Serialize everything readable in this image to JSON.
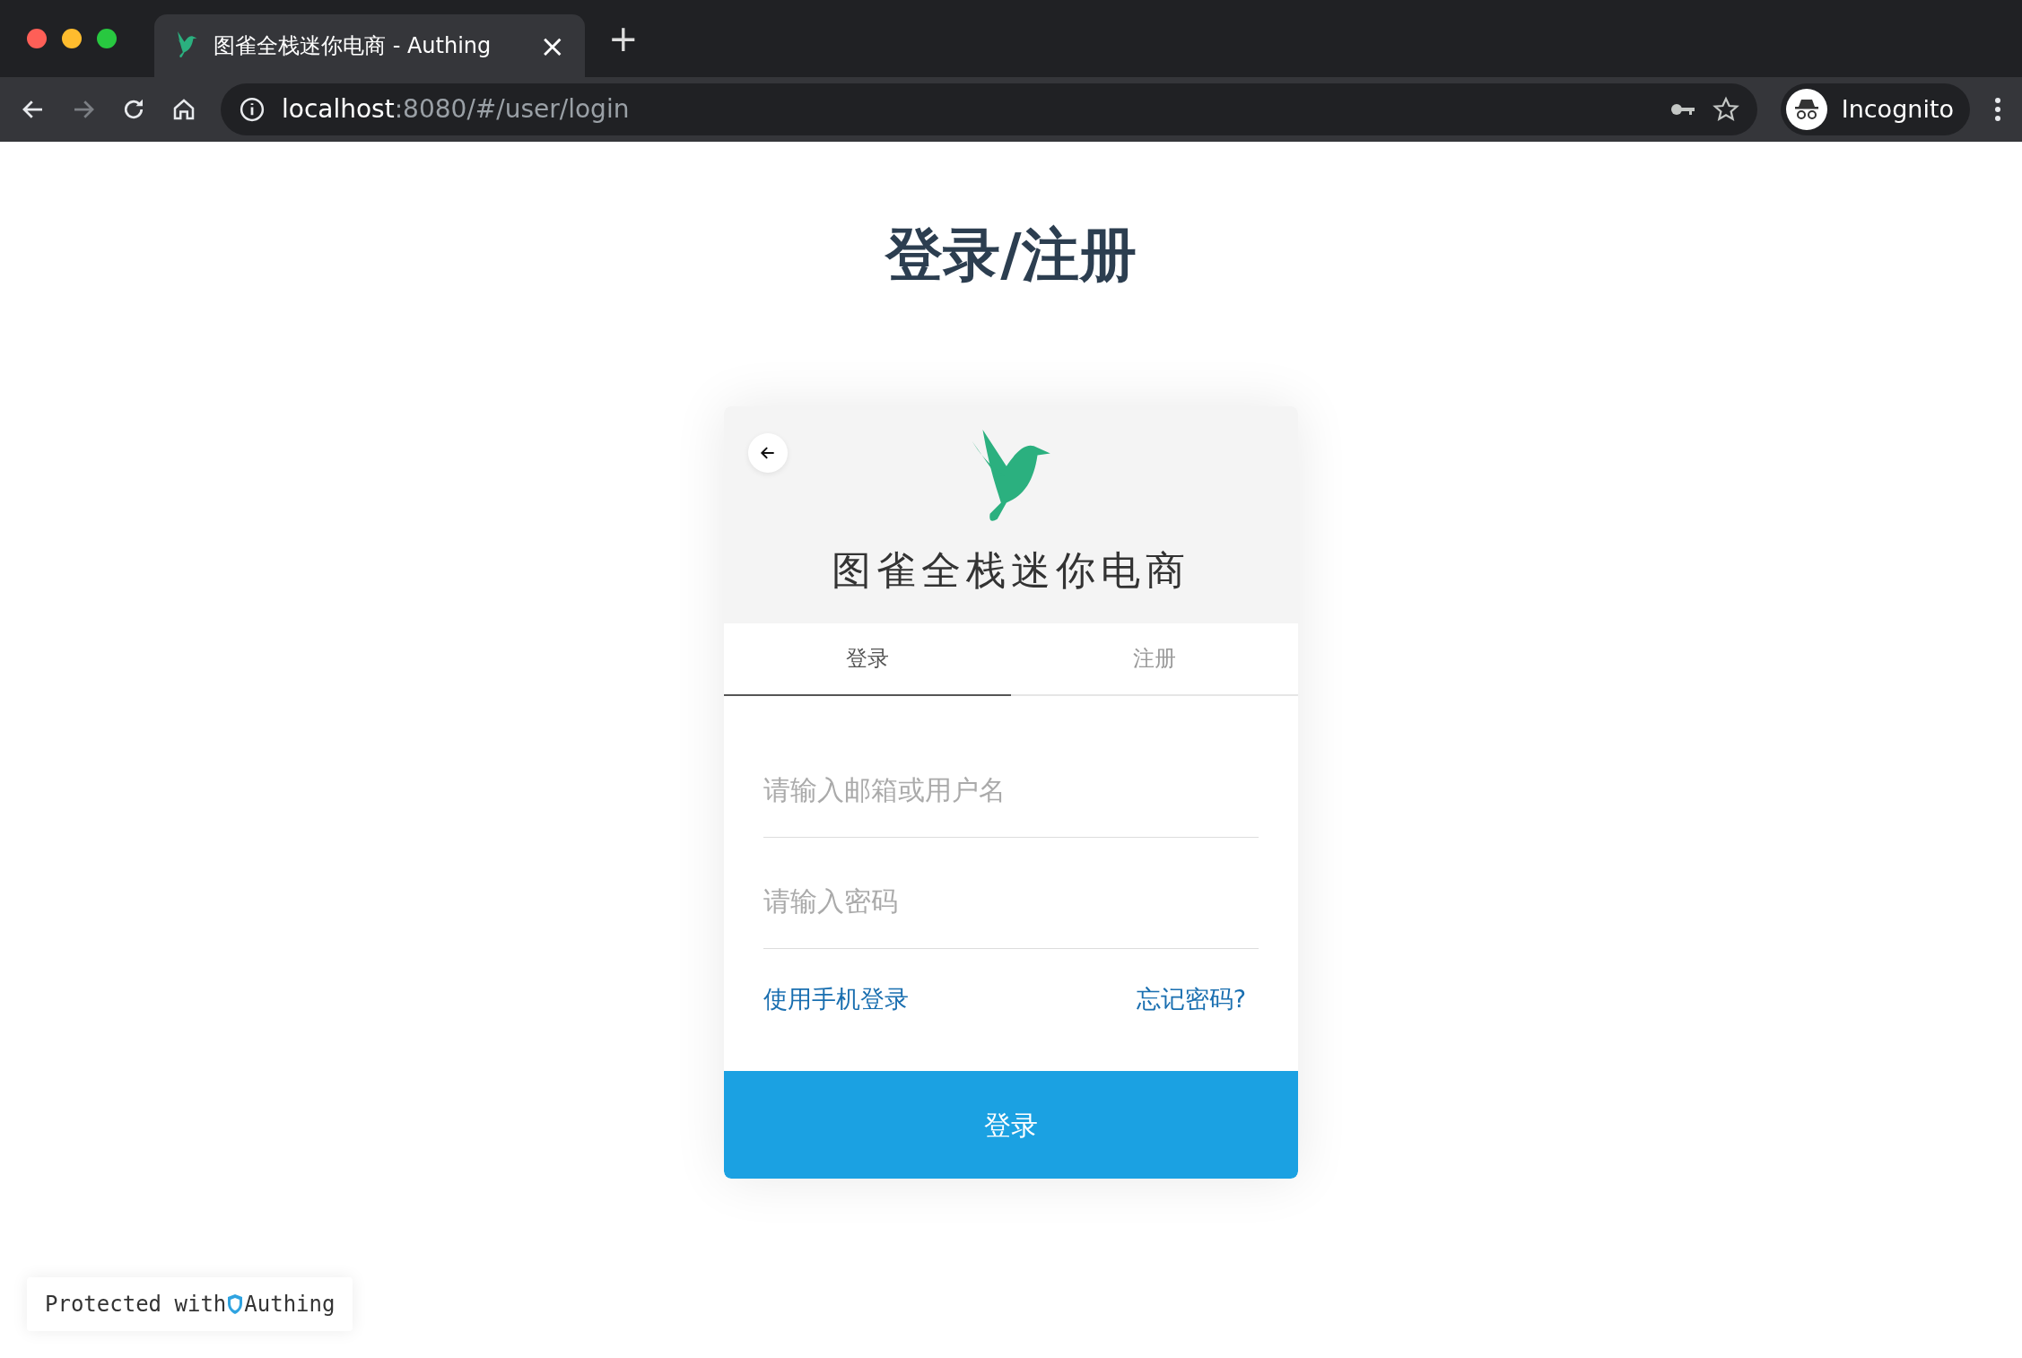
{
  "browser": {
    "tab": {
      "title": "图雀全栈迷你电商 - Authing",
      "close": "×",
      "selected": true
    },
    "new_tab": "+",
    "address": {
      "host": "localhost",
      "path": ":8080/#/user/login"
    },
    "profile": "Incognito"
  },
  "page": {
    "title": "登录/注册"
  },
  "card": {
    "app_name": "图雀全栈迷你电商",
    "tabs": [
      {
        "label": "登录",
        "selected": true
      },
      {
        "label": "注册",
        "selected": false
      }
    ],
    "fields": [
      {
        "placeholder": "请输入邮箱或用户名"
      },
      {
        "placeholder": "请输入密码"
      }
    ],
    "links": [
      "使用手机登录",
      "忘记密码?"
    ],
    "submit": "登录"
  },
  "footer": {
    "before": "Protected with",
    "after": "Authing"
  }
}
